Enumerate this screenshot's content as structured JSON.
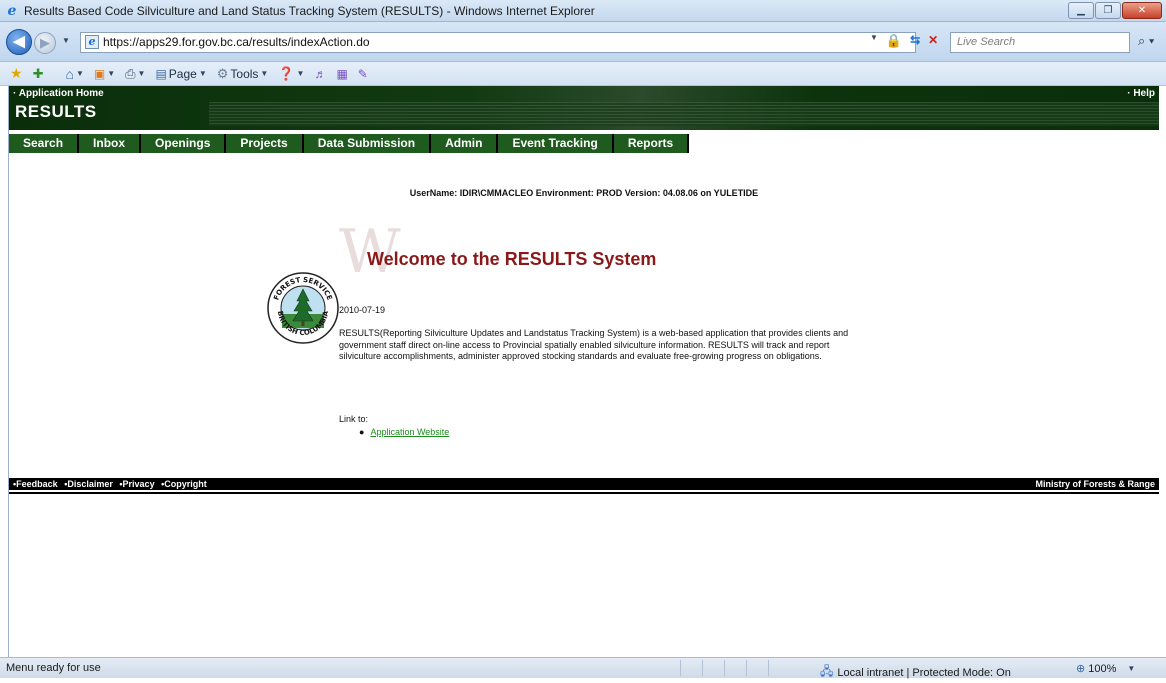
{
  "browser": {
    "title": "Results Based Code Silviculture and Land Status Tracking System (RESULTS) - Windows Internet Explorer",
    "url": "https://apps29.for.gov.bc.ca/results/indexAction.do",
    "search_placeholder": "Live Search",
    "toolbar": {
      "page_label": "Page",
      "tools_label": "Tools"
    },
    "status": {
      "text": "Menu ready for use",
      "zone": "Local intranet | Protected Mode: On",
      "zoom": "100%"
    }
  },
  "app": {
    "home_link": "· Application Home",
    "help_link": "· Help",
    "title": "RESULTS",
    "menu": [
      "Search",
      "Inbox",
      "Openings",
      "Projects",
      "Data Submission",
      "Admin",
      "Event Tracking",
      "Reports"
    ],
    "user_info": "UserName: IDIR\\CMMACLEO Environment: PROD Version: 04.08.06 on YULETIDE",
    "welcome_initial": "W",
    "welcome": "Welcome to the RESULTS System",
    "logo_text": {
      "top": "FOREST SERVICE",
      "bottom": "BRITISH COLUMBIA"
    },
    "date": "2010-07-19",
    "description": "RESULTS(Reporting Silviculture Updates and Landstatus Tracking System) is a web-based application that provides clients and government staff direct on-line access to Provincial spatially enabled silviculture information. RESULTS will track and report silviculture accomplishments, administer approved stocking standards and evaluate free-growing progress on obligations.",
    "link_to": "Link to:",
    "link_label": "Application Website",
    "footer": {
      "links": [
        "•Feedback",
        "•Disclaimer",
        "•Privacy",
        "•Copyright"
      ],
      "ministry": "Ministry of Forests & Range"
    }
  },
  "colors": {
    "header_green": "#0a2e0a",
    "menu_green": "#1f5a1f",
    "welcome_red": "#8a1a1a",
    "link_green": "#1e8c1e"
  }
}
